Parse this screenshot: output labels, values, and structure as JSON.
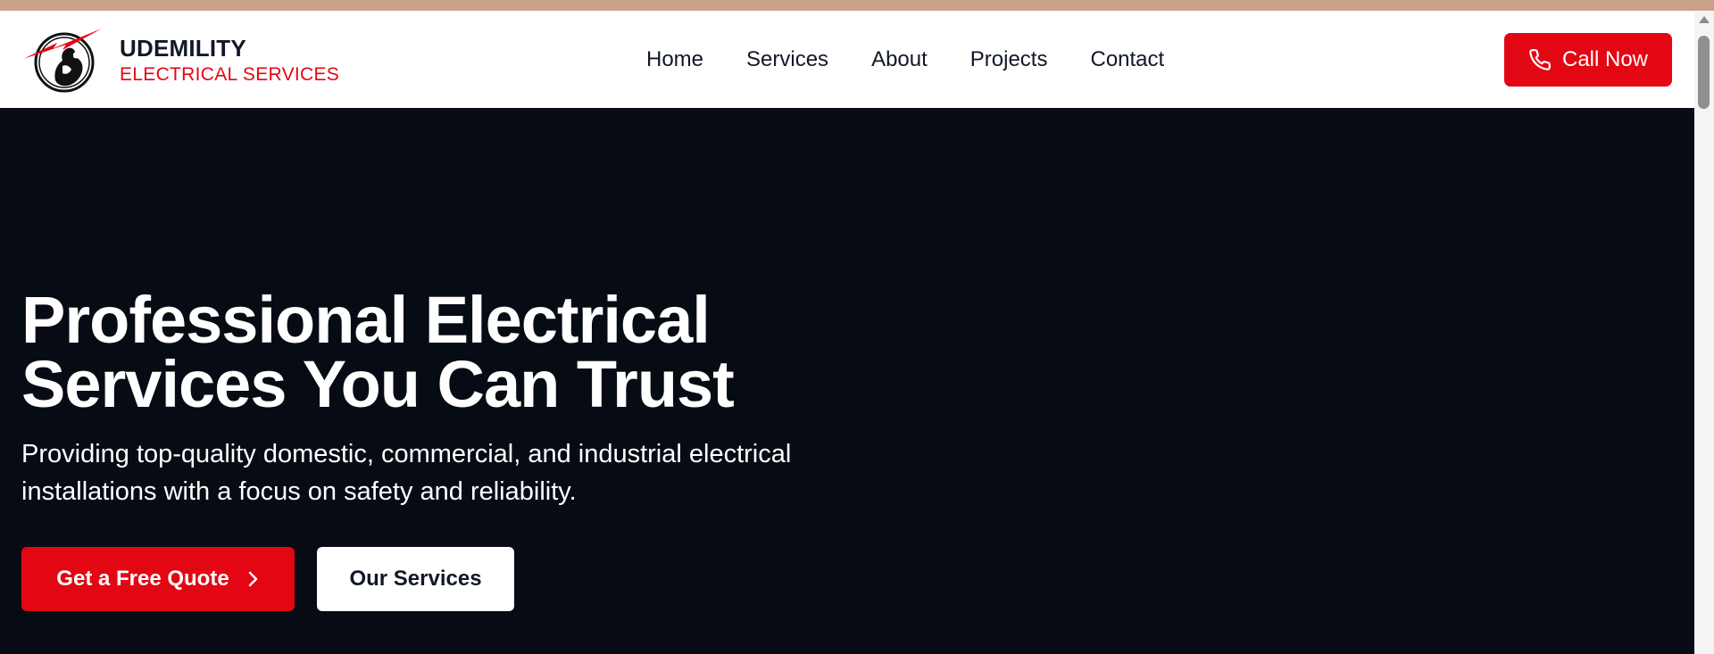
{
  "brand": {
    "name": "UDEMILITY",
    "tagline": "ELECTRICAL SERVICES",
    "logo_icon": "electrician-bolt-logo"
  },
  "nav": {
    "items": [
      {
        "label": "Home"
      },
      {
        "label": "Services"
      },
      {
        "label": "About"
      },
      {
        "label": "Projects"
      },
      {
        "label": "Contact"
      }
    ]
  },
  "header": {
    "call_label": "Call Now",
    "call_icon": "phone-icon"
  },
  "hero": {
    "title_line1": "Professional Electrical",
    "title_line2": "Services You Can Trust",
    "subtitle": "Providing top-quality domestic, commercial, and industrial electrical installations with a focus on safety and reliability.",
    "primary_cta": "Get a Free Quote",
    "primary_cta_icon": "chevron-right-icon",
    "secondary_cta": "Our Services"
  },
  "colors": {
    "accent": "#e30613",
    "hero_bg": "#070b14",
    "text_dark": "#111827",
    "top_strip": "#caa08b"
  }
}
